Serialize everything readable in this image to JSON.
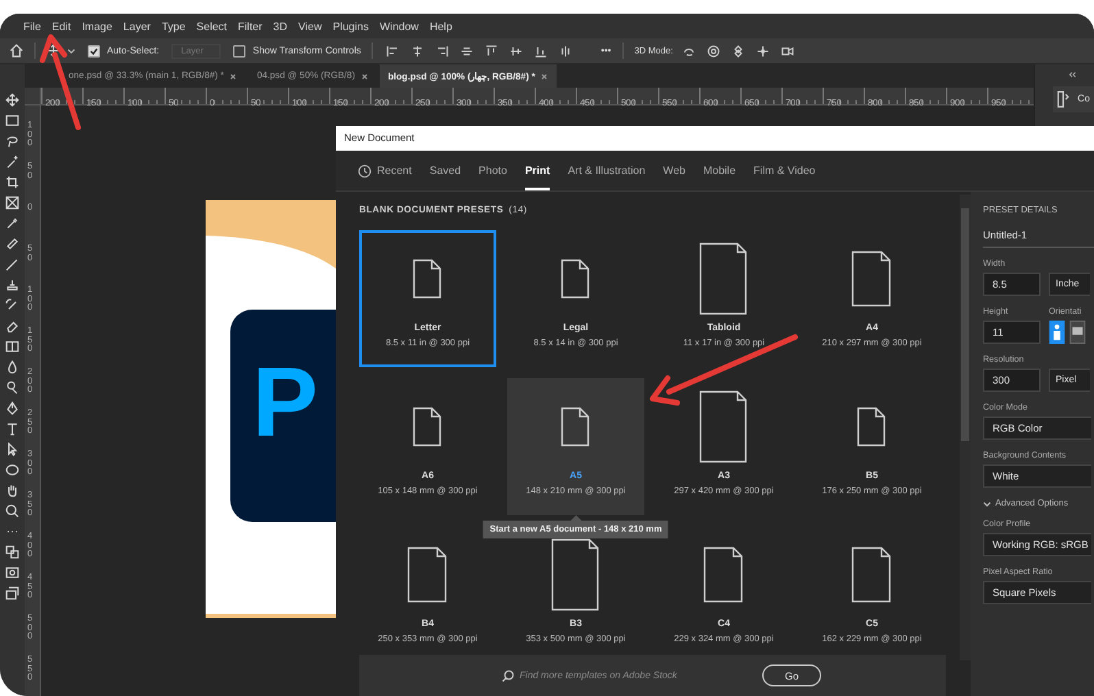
{
  "menu_bar": {
    "items": [
      "File",
      "Edit",
      "Image",
      "Layer",
      "Type",
      "Select",
      "Filter",
      "3D",
      "View",
      "Plugins",
      "Window",
      "Help"
    ]
  },
  "options_bar": {
    "auto_select": {
      "label": "Auto-Select:",
      "checked": true
    },
    "target": {
      "value": "Layer",
      "disabled": true
    },
    "transform_controls": {
      "label": "Show Transform Controls",
      "checked": false
    },
    "more": "•••",
    "mode_label": "3D Mode:"
  },
  "document_tabs": [
    {
      "label": "one.psd @ 33.3% (main 1, RGB/8#) *",
      "selected": false
    },
    {
      "label": "04.psd @ 50% (RGB/8)",
      "selected": false
    },
    {
      "label": "blog.psd @ 100% (چهار, RGB/8#) *",
      "selected": true
    }
  ],
  "rulers": {
    "horizontal": [
      "200",
      "150",
      "100",
      "50",
      "0",
      "50",
      "100",
      "150",
      "200",
      "250",
      "300",
      "350",
      "400",
      "450",
      "500",
      "550",
      "600",
      "650",
      "700",
      "750",
      "800",
      "850",
      "900",
      "950"
    ],
    "vertical": [
      "100",
      "50",
      "0",
      "50",
      "100",
      "150",
      "200",
      "250",
      "300",
      "350",
      "400",
      "450",
      "500",
      "550"
    ]
  },
  "canvas": {
    "document": {
      "logo_text": "P"
    }
  },
  "dock": {
    "label": "Co"
  },
  "dialog": {
    "title": "New Document",
    "tabs": [
      {
        "label": "Recent",
        "kind": "history",
        "selected": false
      },
      {
        "label": "Saved",
        "kind": "text",
        "selected": false
      },
      {
        "label": "Photo",
        "kind": "text",
        "selected": false
      },
      {
        "label": "Print",
        "kind": "text",
        "selected": true
      },
      {
        "label": "Art & Illustration",
        "kind": "text",
        "selected": false
      },
      {
        "label": "Web",
        "kind": "text",
        "selected": false
      },
      {
        "label": "Mobile",
        "kind": "text",
        "selected": false
      },
      {
        "label": "Film & Video",
        "kind": "text",
        "selected": false
      }
    ],
    "presets_heading": "BLANK DOCUMENT PRESETS",
    "presets_count": "(14)",
    "presets": [
      {
        "name": "Letter",
        "size": "8.5 x 11 in @ 300 ppi",
        "kind": "small",
        "selected": true,
        "hovered": false
      },
      {
        "name": "Legal",
        "size": "8.5 x 14 in @ 300 ppi",
        "kind": "small",
        "selected": false,
        "hovered": false
      },
      {
        "name": "Tabloid",
        "size": "11 x 17 in @ 300 ppi",
        "kind": "large",
        "selected": false,
        "hovered": false
      },
      {
        "name": "A4",
        "size": "210 x 297 mm @ 300 ppi",
        "kind": "medium",
        "selected": false,
        "hovered": false
      },
      {
        "name": "A6",
        "size": "105 x 148 mm @ 300 ppi",
        "kind": "small",
        "selected": false,
        "hovered": false
      },
      {
        "name": "A5",
        "size": "148 x 210 mm @ 300 ppi",
        "kind": "small",
        "selected": false,
        "hovered": true,
        "tooltip": "Start a new A5 document - 148 x 210 mm"
      },
      {
        "name": "A3",
        "size": "297 x 420 mm @ 300 ppi",
        "kind": "large",
        "selected": false,
        "hovered": false
      },
      {
        "name": "B5",
        "size": "176 x 250 mm @ 300 ppi",
        "kind": "small",
        "selected": false,
        "hovered": false
      },
      {
        "name": "B4",
        "size": "250 x 353 mm @ 300 ppi",
        "kind": "medium",
        "selected": false,
        "hovered": false
      },
      {
        "name": "B3",
        "size": "353 x 500 mm @ 300 ppi",
        "kind": "large",
        "selected": false,
        "hovered": false
      },
      {
        "name": "C4",
        "size": "229 x 324 mm @ 300 ppi",
        "kind": "medium",
        "selected": false,
        "hovered": false
      },
      {
        "name": "C5",
        "size": "162 x 229 mm @ 300 ppi",
        "kind": "medium",
        "selected": false,
        "hovered": false
      }
    ],
    "search": {
      "placeholder": "Find more templates on Adobe Stock"
    },
    "go_button": "Go",
    "details": {
      "heading": "PRESET DETAILS",
      "name": "Untitled-1",
      "width": {
        "label": "Width",
        "value": "8.5",
        "unit": "Inche"
      },
      "height": {
        "label": "Height",
        "value": "11"
      },
      "orientation": {
        "label": "Orientati",
        "options": [
          {
            "kind": "portrait",
            "selected": true
          },
          {
            "kind": "landscape",
            "selected": false
          }
        ]
      },
      "resolution": {
        "label": "Resolution",
        "value": "300",
        "unit": "Pixel"
      },
      "color_mode": {
        "label": "Color Mode",
        "value": "RGB Color"
      },
      "background": {
        "label": "Background Contents",
        "value": "White"
      },
      "advanced": {
        "label": "Advanced Options",
        "expanded": true
      },
      "color_profile": {
        "label": "Color Profile",
        "value": "Working RGB: sRGB"
      },
      "pixel_aspect": {
        "label": "Pixel Aspect Ratio",
        "value": "Square Pixels"
      }
    }
  }
}
